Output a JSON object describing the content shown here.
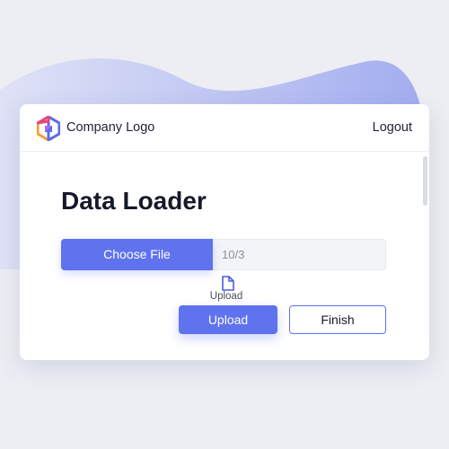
{
  "header": {
    "logo_text": "Company Logo",
    "logout_label": "Logout"
  },
  "main": {
    "title": "Data Loader",
    "file_input": {
      "button_label": "Choose File",
      "value": "10/3"
    },
    "upload_hint": "Upload",
    "upload_button_label": "Upload",
    "finish_button_label": "Finish"
  },
  "icons": {
    "logo": "hexagon-logo-icon",
    "upload_hint": "document-icon"
  },
  "colors": {
    "accent": "#5f73ee",
    "background": "#eceef3",
    "blob": "#aeb6f0",
    "card": "#ffffff",
    "text": "#16192a"
  }
}
